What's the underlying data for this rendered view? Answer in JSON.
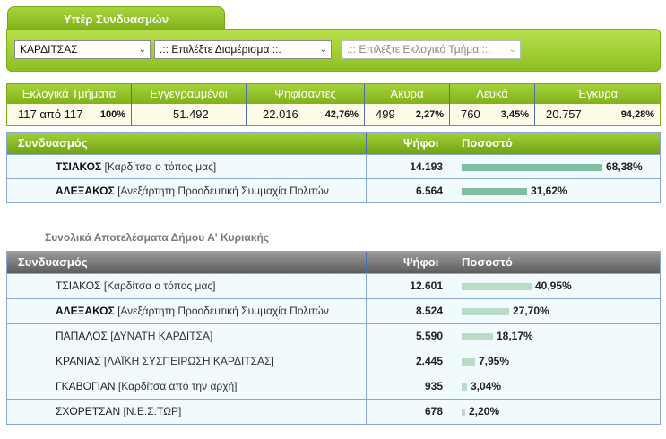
{
  "tab": {
    "label": "Υπέρ Συνδυασμών"
  },
  "filters": {
    "municipality": "ΚΑΡΔΙΤΣΑΣ",
    "district": ".:: Επιλέξτε Διαμέρισμα ::.",
    "precinct": ".:: Επιλέξτε Εκλογικό Τμήμα ::."
  },
  "stats": [
    {
      "label": "Εκλογικά Τμήματα",
      "value": "117 από 117",
      "pct": "100%"
    },
    {
      "label": "Εγγεγραμμένοι",
      "value": "51.492",
      "pct": ""
    },
    {
      "label": "Ψηφίσαντες",
      "value": "22.016",
      "pct": "42,76%"
    },
    {
      "label": "Άκυρα",
      "value": "499",
      "pct": "2,27%"
    },
    {
      "label": "Λευκά",
      "value": "760",
      "pct": "3,45%"
    },
    {
      "label": "Έγκυρα",
      "value": "20.757",
      "pct": "94,28%"
    }
  ],
  "table1": {
    "col_party": "Συνδυασμός",
    "col_votes": "Ψήφοι",
    "col_pct": "Ποσοστό",
    "rows": [
      {
        "leader": "ΤΣΙΑΚΟΣ",
        "desc": "[Καρδίτσα ο τόπος μας]",
        "votes": "14.193",
        "pct": "68,38%",
        "share": 0.6838
      },
      {
        "leader": "ΑΛΕΞΑΚΟΣ",
        "desc": "[Ανεξάρτητη Προοδευτική Συμμαχία Πολιτών",
        "votes": "6.564",
        "pct": "31,62%",
        "share": 0.3162
      }
    ]
  },
  "subtitle": "Συνολικά Αποτελέσματα Δήμου Α' Κυριακής",
  "table2": {
    "col_party": "Συνδυασμός",
    "col_votes": "Ψήφοι",
    "col_pct": "Ποσοστό",
    "rows": [
      {
        "leader": "ΤΣΙΑΚΟΣ",
        "desc": "[Καρδίτσα ο τόπος μας]",
        "votes": "12.601",
        "pct": "40,95%",
        "share": 0.4095,
        "bold": false
      },
      {
        "leader": "ΑΛΕΞΑΚΟΣ",
        "desc": "[Ανεξάρτητη Προοδευτική Συμμαχία Πολιτών",
        "votes": "8.524",
        "pct": "27,70%",
        "share": 0.277,
        "bold": true
      },
      {
        "leader": "ΠΑΠΑΛΟΣ",
        "desc": "[ΔΥΝΑΤΗ ΚΑΡΔΙΤΣΑ]",
        "votes": "5.590",
        "pct": "18,17%",
        "share": 0.1817,
        "bold": false
      },
      {
        "leader": "ΚΡΑΝΙΑΣ",
        "desc": "[ΛΑΪΚΗ ΣΥΣΠΕΙΡΩΣΗ ΚΑΡΔΙΤΣΑΣ]",
        "votes": "2.445",
        "pct": "7,95%",
        "share": 0.0795,
        "bold": false
      },
      {
        "leader": "ΓΚΑΒΟΓΙΑΝ",
        "desc": "[Καρδίτσα από την αρχή]",
        "votes": "935",
        "pct": "3,04%",
        "share": 0.0304,
        "bold": false
      },
      {
        "leader": "ΣΧΟΡΕΤΣΑΝ",
        "desc": "[Ν.Ε.Σ.ΤΩΡ]",
        "votes": "678",
        "pct": "2,20%",
        "share": 0.022,
        "bold": false
      }
    ]
  },
  "colors": {
    "green": "#8cc021",
    "bar1": "#7fbfa0",
    "bar2": "#b8dcc6"
  }
}
